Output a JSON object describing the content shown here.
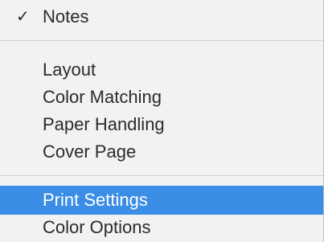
{
  "menu": {
    "checked_item": {
      "check_glyph": "✓",
      "label": "Notes"
    },
    "group1": [
      {
        "label": "Layout"
      },
      {
        "label": "Color Matching"
      },
      {
        "label": "Paper Handling"
      },
      {
        "label": "Cover Page"
      }
    ],
    "group2": [
      {
        "label": "Print Settings",
        "state": "highlighted"
      },
      {
        "label": "Color Options"
      }
    ],
    "colors": {
      "menu_background": "#f2f2f2",
      "highlight": "#3b8de6",
      "text": "#2b2b2b",
      "highlight_text": "#ffffff"
    }
  }
}
